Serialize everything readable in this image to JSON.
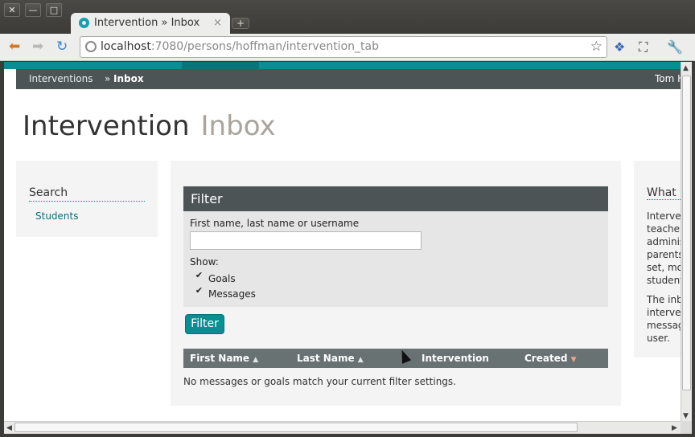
{
  "browser": {
    "tab_title": "Intervention » Inbox",
    "tab_close": "×",
    "newtab": "+",
    "url_host": "localhost",
    "url_rest": ":7080/persons/hoffman/intervention_tab",
    "controls": {
      "close": "✕",
      "minimize": "—",
      "maximize": "□"
    },
    "icons": {
      "back": "back-arrow-icon",
      "forward": "forward-arrow-icon",
      "reload": "reload-icon",
      "bookmark": "star-icon"
    }
  },
  "page": {
    "breadcrumb": {
      "parent": "Interventions",
      "separator": "»",
      "current": "Inbox"
    },
    "user": "Tom H",
    "title": "Intervention",
    "title_sub": "Inbox",
    "sidebar": {
      "heading": "Search",
      "link": "Students"
    },
    "filter": {
      "heading": "Filter",
      "name_label": "First name, last name or username",
      "name_value": "",
      "show_label": "Show:",
      "options": [
        {
          "label": "Goals",
          "checked": true
        },
        {
          "label": "Messages",
          "checked": true
        }
      ],
      "button": "Filter"
    },
    "table": {
      "columns": [
        "First Name",
        "Last Name",
        "Intervention",
        "Created"
      ],
      "empty_message": "No messages or goals match your current filter settings."
    },
    "right": {
      "heading": "What i",
      "para1": [
        "Interve",
        "teacher",
        "adminis",
        "parents",
        "set, mo",
        "student"
      ],
      "para2": [
        "The inb",
        "interve",
        "messag",
        "user."
      ]
    }
  },
  "colors": {
    "accent": "#0a8d93",
    "header": "#4c5455",
    "table_head": "#687273"
  }
}
